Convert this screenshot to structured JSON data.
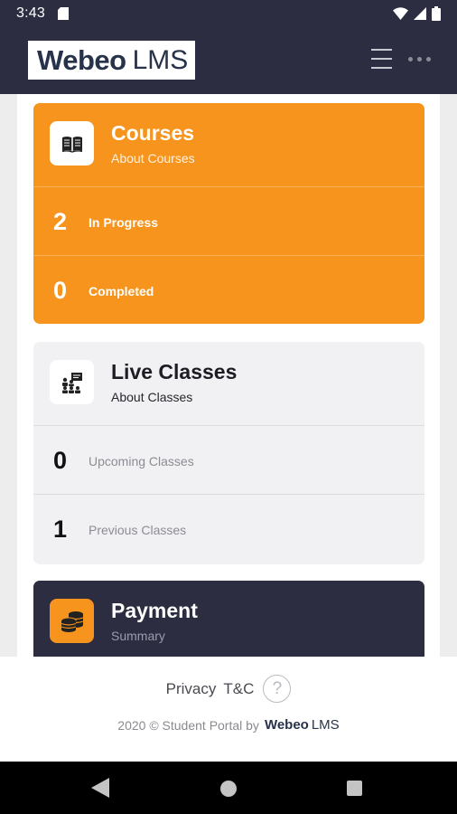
{
  "status_bar": {
    "time": "3:43",
    "icons": [
      "sd-card-icon",
      "wifi-icon",
      "signal-icon",
      "battery-icon"
    ]
  },
  "header": {
    "logo": {
      "brand": "Webeo",
      "product": "LMS"
    },
    "icons": [
      "hamburger-menu-icon",
      "more-options-icon"
    ],
    "colors": {
      "background": "#2c2d40",
      "logo_text": "#27324b"
    }
  },
  "courses_card": {
    "title": "Courses",
    "subtitle": "About Courses",
    "icon": "book-icon",
    "color": "#f7941d",
    "stats": [
      {
        "value": "2",
        "label": "In Progress"
      },
      {
        "value": "0",
        "label": "Completed"
      }
    ]
  },
  "live_classes_card": {
    "title": "Live Classes",
    "subtitle": "About Classes",
    "icon": "classroom-icon",
    "color": "#f1f1f3",
    "stats": [
      {
        "value": "0",
        "label": "Upcoming Classes"
      },
      {
        "value": "1",
        "label": "Previous Classes"
      }
    ]
  },
  "payment_card": {
    "title": "Payment",
    "subtitle": "Summary",
    "icon": "coins-icon",
    "color": "#2c2d40"
  },
  "footer": {
    "links": [
      "Privacy",
      "T&C"
    ],
    "help_icon": "help-icon",
    "copyright": "2020 © Student Portal by",
    "brand": {
      "name": "Webeo",
      "product": "LMS"
    }
  },
  "nav_bar": {
    "icons": [
      "back-icon",
      "home-icon",
      "recent-apps-icon"
    ]
  }
}
